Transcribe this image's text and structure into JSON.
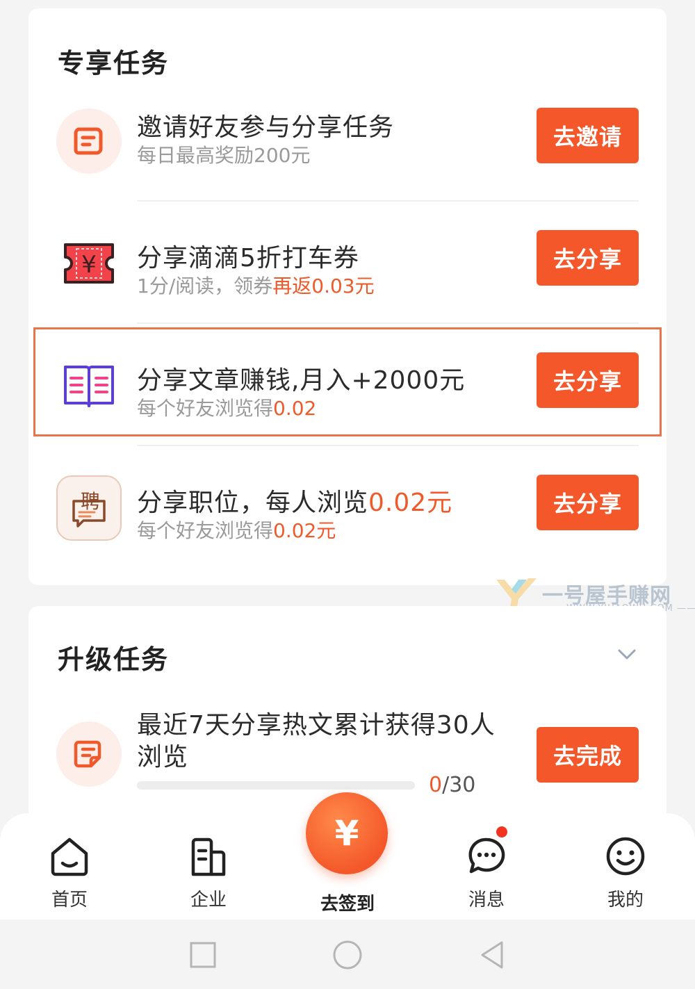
{
  "exclusive": {
    "title": "专享任务",
    "tasks": [
      {
        "icon": "chat-document-icon",
        "title": "邀请好友参与分享任务",
        "sub": "每日最高奖励200元",
        "sub_hl": "",
        "button": "去邀请"
      },
      {
        "icon": "yuan-ticket-icon",
        "title": "分享滴滴5折打车券",
        "sub": "1分/阅读，领券",
        "sub_hl": "再返0.03元",
        "button": "去分享",
        "ticket_char": "¥"
      },
      {
        "icon": "open-book-icon",
        "title": "分享文章赚钱,月入+2000元",
        "sub": "每个好友浏览得",
        "sub_hl": "0.02",
        "button": "去分享"
      },
      {
        "icon": "hiring-icon",
        "title_a": "分享职位，每人浏览",
        "title_hl": "0.02元",
        "sub": "每个好友浏览得",
        "sub_hl": "0.02元",
        "button": "去分享",
        "hire_char": "聘"
      }
    ]
  },
  "upgrade": {
    "title": "升级任务",
    "task": {
      "icon": "edit-document-icon",
      "title_line1": "最近7天分享热文累计获得30人",
      "title_line2": "浏览",
      "progress_current": "0",
      "progress_total": "/30",
      "progress_fraction": 0,
      "button": "去完成"
    }
  },
  "watermark": {
    "text": "一号屋手赚网",
    "url": "—— WWW.YIHAOWU.COM ——"
  },
  "nav": {
    "home": "首页",
    "company": "企业",
    "checkin": "去签到",
    "checkin_symbol": "¥",
    "messages": "消息",
    "mine": "我的"
  },
  "colors": {
    "accent": "#f4582a",
    "highlight_text": "#f05a2a",
    "badge": "#f2331f"
  }
}
